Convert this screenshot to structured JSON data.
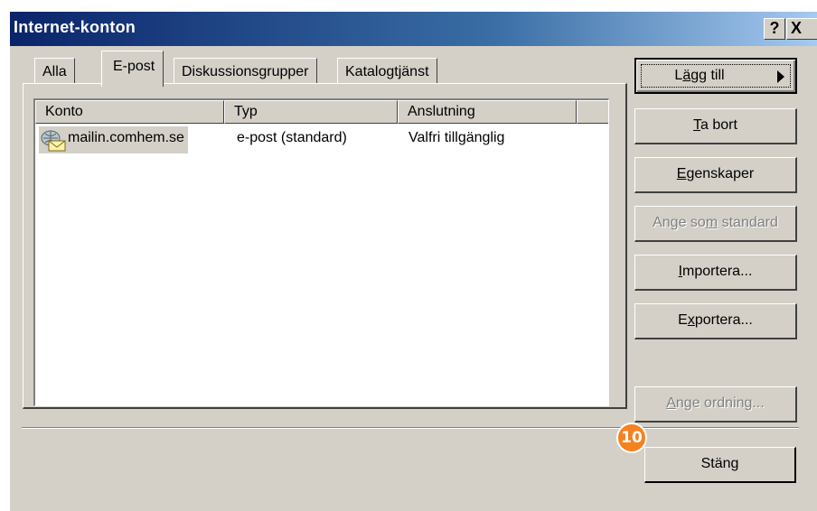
{
  "window": {
    "title": "Internet-konton",
    "help_button": "?",
    "close_button": "X"
  },
  "tabs": [
    {
      "label": "Alla",
      "active": false
    },
    {
      "label": "E-post",
      "active": true
    },
    {
      "label": "Diskussionsgrupper",
      "active": false
    },
    {
      "label": "Katalogtjänst",
      "active": false
    }
  ],
  "list": {
    "columns": [
      "Konto",
      "Typ",
      "Anslutning"
    ],
    "rows": [
      {
        "account": "mailin.comhem.se",
        "type": "e-post (standard)",
        "connection": "Valfri tillgänglig",
        "icon": "mail-account-icon",
        "selected": true
      }
    ]
  },
  "buttons": {
    "add": {
      "pre": "L",
      "ul": "ä",
      "post": "gg till"
    },
    "remove": {
      "pre": "",
      "ul": "T",
      "post": "a bort"
    },
    "properties": {
      "pre": "",
      "ul": "E",
      "post": "genskaper"
    },
    "set_default": {
      "pre": "Ange so",
      "ul": "m",
      "post": " standard"
    },
    "import": {
      "pre": "",
      "ul": "I",
      "post": "mportera..."
    },
    "export": {
      "pre": "E",
      "ul": "x",
      "post": "portera..."
    },
    "order": {
      "pre": "",
      "ul": "A",
      "post": "nge ordning..."
    },
    "close": {
      "label": "Stäng"
    }
  },
  "badge": {
    "number": "10",
    "color": "#f58220"
  },
  "colors": {
    "face": "#d4d0c8",
    "title_start": "#0a246a",
    "title_end": "#a6caf0"
  }
}
